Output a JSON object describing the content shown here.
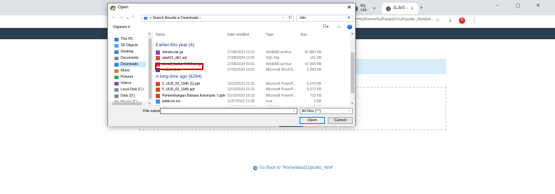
{
  "browser": {
    "tabs": [
      {
        "label": "My site"
      },
      {
        "label": "SLiMS - "
      }
    ],
    "new_tab": "+",
    "window_controls": {
      "minimize": "–",
      "maximize": "▢",
      "close": "✕"
    },
    "url_fragment": "r=%2Fhome%2Falast21%2Fpublic_html&dr..."
  },
  "page": {
    "go_back_label": "Go Back to \"/home/alast21/public_html\""
  },
  "dialog": {
    "title": "Open",
    "close": "✕",
    "nav": {
      "back": "←",
      "forward": "→",
      "down": "⌄",
      "up": "↑"
    },
    "address": {
      "sep": "«",
      "path": "Search Results in Downloads",
      "sep2": "›"
    },
    "search_value": "slim",
    "search_clear": "✕",
    "toolbar": {
      "organize": "Organize ▾"
    },
    "sidebar": [
      {
        "label": "This PC",
        "icon_color": "#3a7bd5"
      },
      {
        "label": "3D Objects",
        "icon_color": "#5aa0e6"
      },
      {
        "label": "Desktop",
        "icon_color": "#2e86de"
      },
      {
        "label": "Documents",
        "icon_color": "#7f8c8d"
      },
      {
        "label": "Downloads",
        "icon_color": "#2e86de",
        "selected": true
      },
      {
        "label": "Music",
        "icon_color": "#e67e22"
      },
      {
        "label": "Pictures",
        "icon_color": "#27ae60"
      },
      {
        "label": "Videos",
        "icon_color": "#8e44ad"
      },
      {
        "label": "Local Disk (C:)",
        "icon_color": "#7f8c8d"
      },
      {
        "label": "Data (D:)",
        "icon_color": "#7f8c8d"
      },
      {
        "label": "Master (E:)",
        "icon_color": "#7f8c8d"
      }
    ],
    "columns": {
      "name": "Name",
      "date": "Date modified",
      "type": "Type",
      "size": "Size"
    },
    "groups": [
      {
        "label": "Earlier this year (4)",
        "files": [
          {
            "name": "slimsku.tar.gz",
            "date": "27/08/2024 12:10",
            "type": "WinRAR archive",
            "size": "47.883 KB",
            "icon_color": "#8e44ad"
          },
          {
            "name": "alast21_db1.sql",
            "date": "27/08/2024 12:05",
            "type": "SQL File",
            "size": "131 KB",
            "icon_color": "#e74c3c"
          },
          {
            "name": "slims9_bulian-9.6.1.tar.gz",
            "date": "27/08/2024 09:03",
            "type": "WinRAR archive",
            "size": "47.934 KB",
            "icon_color": "#8e44ad"
          },
          {
            "name": "...ulian.docx",
            "date": "27/02/2024 10:02",
            "type": "Microsoft Word D...",
            "size": "1.380 KB",
            "icon_color": "#2b579a"
          }
        ]
      },
      {
        "label": "A long time ago (6294)",
        "files": [
          {
            "name": "5. UUD_RI_1945 (1).ppt",
            "date": "12/10/2023 21:31",
            "type": "Microsoft PowerP...",
            "size": "5.370 KB",
            "icon_color": "#d24726"
          },
          {
            "name": "5. UUD_RI_1945.ppt",
            "date": "12/10/2023 21:31",
            "type": "Microsoft PowerP...",
            "size": "5.372 KB",
            "icon_color": "#d24726"
          },
          {
            "name": "Perkembangan Bahasa Kelompok 7.pptx",
            "date": "01/10/2023 18:32",
            "type": "Microsoft PowerP...",
            "size": "733 KB",
            "icon_color": "#d24726"
          },
          {
            "name": "webicon.ico",
            "date": "11/07/2023 10:39",
            "type": "Icon",
            "size": "2 KB",
            "icon_color": "#3498db"
          },
          {
            "name": "...ample.html",
            "date": "11/07/2023 10:38",
            "type": "HTML File",
            "size": "1 KB",
            "icon_color": "#95a5a6"
          }
        ]
      }
    ],
    "file_name_label": "File name:",
    "file_name_value": "",
    "file_type": "All Files (*.*)",
    "buttons": {
      "open": "Open",
      "cancel": "Cancel"
    }
  }
}
